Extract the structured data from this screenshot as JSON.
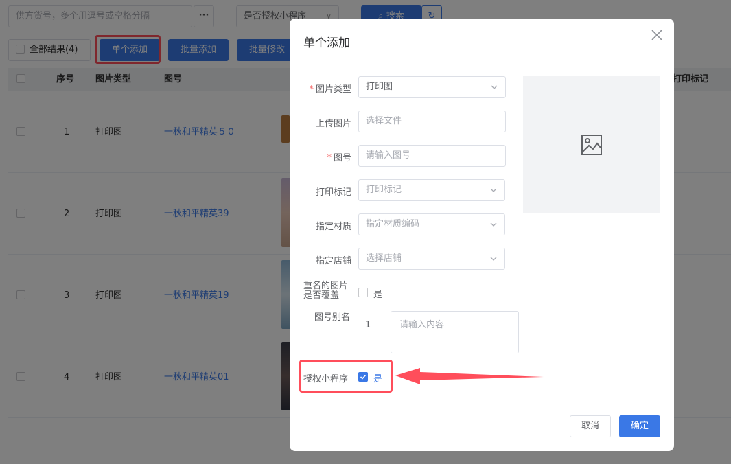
{
  "toolbar": {
    "search_placeholder": "供方货号，多个用逗号或空格分隔",
    "more_label": "···",
    "auth_select_placeholder": "是否授权小程序",
    "search_button": "搜索",
    "all_results": "全部结果(4)",
    "single_add": "单个添加",
    "batch_add": "批量添加",
    "batch_edit": "批量修改"
  },
  "table": {
    "columns": [
      "序号",
      "图片类型",
      "图号",
      "打印标记"
    ],
    "rows": [
      {
        "index": "1",
        "type": "打印图",
        "code": "一秋和平精英５０"
      },
      {
        "index": "2",
        "type": "打印图",
        "code": "一秋和平精英39"
      },
      {
        "index": "3",
        "type": "打印图",
        "code": "一秋和平精英19"
      },
      {
        "index": "4",
        "type": "打印图",
        "code": "一秋和平精英01"
      }
    ]
  },
  "modal": {
    "title": "单个添加",
    "fields": {
      "image_type": {
        "label": "图片类型",
        "value": "打印图"
      },
      "upload": {
        "label": "上传图片",
        "placeholder": "选择文件"
      },
      "image_code": {
        "label": "图号",
        "placeholder": "请输入图号"
      },
      "print_mark": {
        "label": "打印标记",
        "placeholder": "打印标记"
      },
      "material": {
        "label": "指定材质",
        "placeholder": "指定材质编码"
      },
      "store": {
        "label": "指定店铺",
        "placeholder": "选择店铺"
      },
      "overwrite": {
        "label_line1": "重名的图片",
        "label_line2": "是否覆盖",
        "option": "是",
        "checked": false
      },
      "alias": {
        "label": "图号别名",
        "index": "1",
        "placeholder": "请输入内容"
      },
      "authorize": {
        "label": "授权小程序",
        "option": "是",
        "checked": true
      }
    },
    "cancel": "取消",
    "confirm": "确定"
  },
  "colors": {
    "primary": "#3a78e6",
    "highlight": "#ff4e5b",
    "required": "#f56c6c"
  }
}
